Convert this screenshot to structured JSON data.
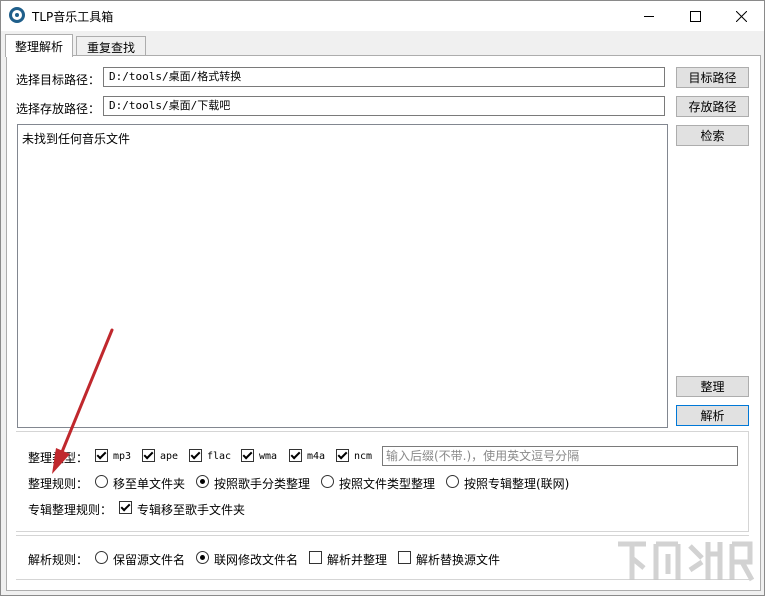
{
  "window": {
    "title": "TLP音乐工具箱"
  },
  "tabs": [
    {
      "label": "整理解析",
      "active": true
    },
    {
      "label": "重复查找",
      "active": false
    }
  ],
  "target_path": {
    "label": "选择目标路径：",
    "value": "D:/tools/桌面/格式转换",
    "button": "目标路径"
  },
  "save_path": {
    "label": "选择存放路径：",
    "value": "D:/tools/桌面/下载吧",
    "button": "存放路径"
  },
  "search_button": "检索",
  "results": {
    "message": "未找到任何音乐文件"
  },
  "organize_button": "整理",
  "parse_button": "解析",
  "organize_type": {
    "label": "整理类型：",
    "formats": [
      {
        "label": "mp3",
        "checked": true
      },
      {
        "label": "ape",
        "checked": true
      },
      {
        "label": "flac",
        "checked": true
      },
      {
        "label": "wma",
        "checked": true
      },
      {
        "label": "m4a",
        "checked": true
      },
      {
        "label": "ncm",
        "checked": true
      }
    ],
    "extension_placeholder": "输入后缀(不带.)，使用英文逗号分隔"
  },
  "organize_rule": {
    "label": "整理规则：",
    "options": [
      {
        "label": "移至单文件夹",
        "checked": false
      },
      {
        "label": "按照歌手分类整理",
        "checked": true
      },
      {
        "label": "按照文件类型整理",
        "checked": false
      },
      {
        "label": "按照专辑整理(联网)",
        "checked": false
      }
    ]
  },
  "album_rule": {
    "label": "专辑整理规则：",
    "option": {
      "label": "专辑移至歌手文件夹",
      "checked": true
    }
  },
  "parse_rule": {
    "label": "解析规则：",
    "radios": [
      {
        "label": "保留源文件名",
        "checked": false
      },
      {
        "label": "联网修改文件名",
        "checked": true
      }
    ],
    "checks": [
      {
        "label": "解析并整理",
        "checked": false
      },
      {
        "label": "解析替换源文件",
        "checked": false
      }
    ]
  },
  "colors": {
    "accent": "#0078d7",
    "annotation_arrow": "#c0282d",
    "icon": "#1f5f8b"
  }
}
